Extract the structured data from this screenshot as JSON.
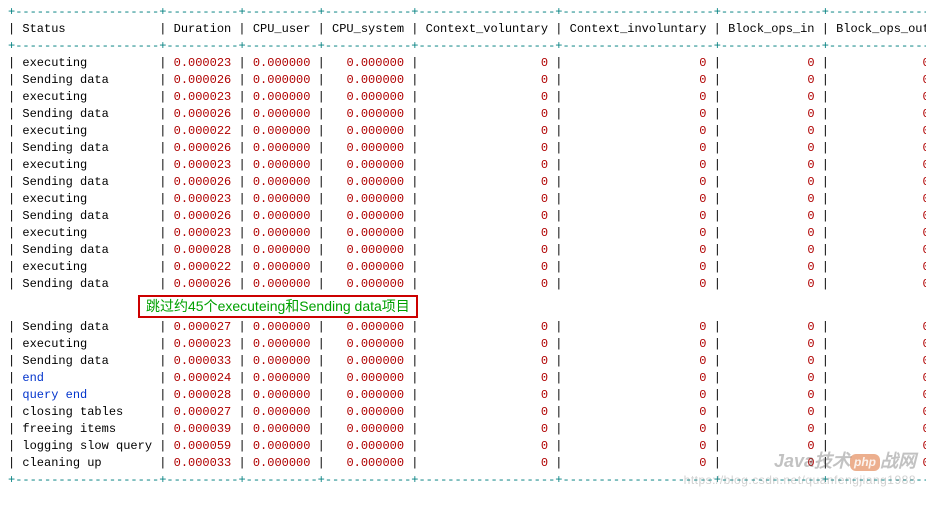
{
  "header": {
    "status": "Status",
    "duration": "Duration",
    "cpu_user": "CPU_user",
    "cpu_system": "CPU_system",
    "ctx_vol": "Context_voluntary",
    "ctx_inv": "Context_involuntary",
    "block_in": "Block_ops_in",
    "block_out": "Block_ops_out"
  },
  "rows_top": [
    {
      "status": "executing",
      "duration": "0.000023",
      "cpu_user": "0.000000",
      "cpu_system": "0.000000",
      "cv": "0",
      "ci": "0",
      "bi": "0",
      "bo": "0"
    },
    {
      "status": "Sending data",
      "duration": "0.000026",
      "cpu_user": "0.000000",
      "cpu_system": "0.000000",
      "cv": "0",
      "ci": "0",
      "bi": "0",
      "bo": "0"
    },
    {
      "status": "executing",
      "duration": "0.000023",
      "cpu_user": "0.000000",
      "cpu_system": "0.000000",
      "cv": "0",
      "ci": "0",
      "bi": "0",
      "bo": "0"
    },
    {
      "status": "Sending data",
      "duration": "0.000026",
      "cpu_user": "0.000000",
      "cpu_system": "0.000000",
      "cv": "0",
      "ci": "0",
      "bi": "0",
      "bo": "0"
    },
    {
      "status": "executing",
      "duration": "0.000022",
      "cpu_user": "0.000000",
      "cpu_system": "0.000000",
      "cv": "0",
      "ci": "0",
      "bi": "0",
      "bo": "0"
    },
    {
      "status": "Sending data",
      "duration": "0.000026",
      "cpu_user": "0.000000",
      "cpu_system": "0.000000",
      "cv": "0",
      "ci": "0",
      "bi": "0",
      "bo": "0"
    },
    {
      "status": "executing",
      "duration": "0.000023",
      "cpu_user": "0.000000",
      "cpu_system": "0.000000",
      "cv": "0",
      "ci": "0",
      "bi": "0",
      "bo": "0"
    },
    {
      "status": "Sending data",
      "duration": "0.000026",
      "cpu_user": "0.000000",
      "cpu_system": "0.000000",
      "cv": "0",
      "ci": "0",
      "bi": "0",
      "bo": "0"
    },
    {
      "status": "executing",
      "duration": "0.000023",
      "cpu_user": "0.000000",
      "cpu_system": "0.000000",
      "cv": "0",
      "ci": "0",
      "bi": "0",
      "bo": "0"
    },
    {
      "status": "Sending data",
      "duration": "0.000026",
      "cpu_user": "0.000000",
      "cpu_system": "0.000000",
      "cv": "0",
      "ci": "0",
      "bi": "0",
      "bo": "0"
    },
    {
      "status": "executing",
      "duration": "0.000023",
      "cpu_user": "0.000000",
      "cpu_system": "0.000000",
      "cv": "0",
      "ci": "0",
      "bi": "0",
      "bo": "0"
    },
    {
      "status": "Sending data",
      "duration": "0.000028",
      "cpu_user": "0.000000",
      "cpu_system": "0.000000",
      "cv": "0",
      "ci": "0",
      "bi": "0",
      "bo": "0"
    },
    {
      "status": "executing",
      "duration": "0.000022",
      "cpu_user": "0.000000",
      "cpu_system": "0.000000",
      "cv": "0",
      "ci": "0",
      "bi": "0",
      "bo": "0"
    },
    {
      "status": "Sending data",
      "duration": "0.000026",
      "cpu_user": "0.000000",
      "cpu_system": "0.000000",
      "cv": "0",
      "ci": "0",
      "bi": "0",
      "bo": "0"
    }
  ],
  "annotation": "跳过约45个executeing和Sending data项目",
  "rows_bot": [
    {
      "status": "Sending data",
      "duration": "0.000027",
      "cpu_user": "0.000000",
      "cpu_system": "0.000000",
      "cv": "0",
      "ci": "0",
      "bi": "0",
      "bo": "0"
    },
    {
      "status": "executing",
      "duration": "0.000023",
      "cpu_user": "0.000000",
      "cpu_system": "0.000000",
      "cv": "0",
      "ci": "0",
      "bi": "0",
      "bo": "0"
    },
    {
      "status": "Sending data",
      "duration": "0.000033",
      "cpu_user": "0.000000",
      "cpu_system": "0.000000",
      "cv": "0",
      "ci": "0",
      "bi": "0",
      "bo": "0"
    },
    {
      "status": "end",
      "duration": "0.000024",
      "cpu_user": "0.000000",
      "cpu_system": "0.000000",
      "cv": "0",
      "ci": "0",
      "bi": "0",
      "bo": "0",
      "blue": true
    },
    {
      "status": "query end",
      "duration": "0.000028",
      "cpu_user": "0.000000",
      "cpu_system": "0.000000",
      "cv": "0",
      "ci": "0",
      "bi": "0",
      "bo": "0",
      "blue": true
    },
    {
      "status": "closing tables",
      "duration": "0.000027",
      "cpu_user": "0.000000",
      "cpu_system": "0.000000",
      "cv": "0",
      "ci": "0",
      "bi": "0",
      "bo": "0"
    },
    {
      "status": "freeing items",
      "duration": "0.000039",
      "cpu_user": "0.000000",
      "cpu_system": "0.000000",
      "cv": "0",
      "ci": "0",
      "bi": "0",
      "bo": "0"
    },
    {
      "status": "logging slow query",
      "duration": "0.000059",
      "cpu_user": "0.000000",
      "cpu_system": "0.000000",
      "cv": "0",
      "ci": "0",
      "bi": "0",
      "bo": "0"
    },
    {
      "status": "cleaning up",
      "duration": "0.000033",
      "cpu_user": "0.000000",
      "cpu_system": "0.000000",
      "cv": "0",
      "ci": "0",
      "bi": "0",
      "bo": "0"
    }
  ],
  "watermark": {
    "line1_a": "Java技术",
    "line1_php": "php",
    "line1_b": "战",
    "line1_c": "网",
    "line2": "https://blog.csdn.net/quanfengjiang1988"
  },
  "sep_line": "+--------------------+----------+----------+------------+-------------------+---------------------+--------------+---------------+"
}
